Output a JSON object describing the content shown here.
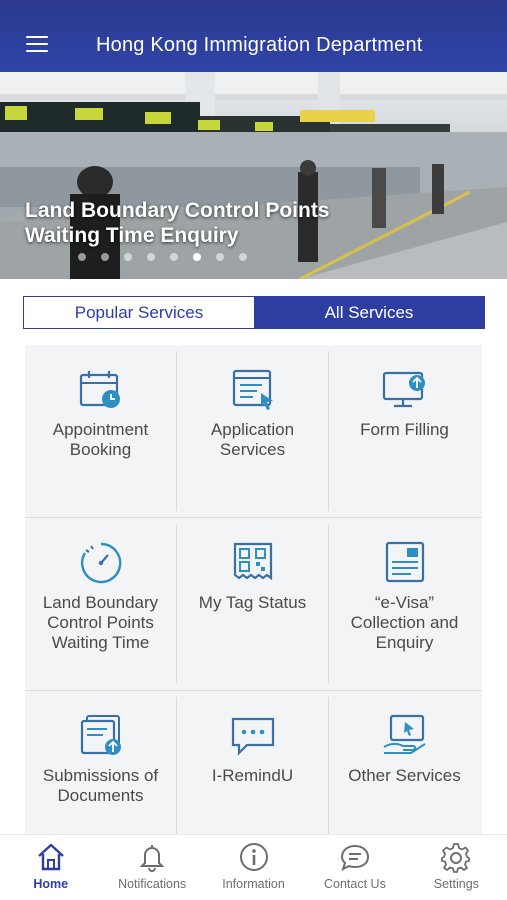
{
  "header": {
    "title": "Hong Kong Immigration Department",
    "menu_icon": "hamburger-icon"
  },
  "banner": {
    "caption_line1": "Land Boundary Control Points",
    "caption_line2": "Waiting Time Enquiry",
    "slide_count": 8,
    "active_slide": 6
  },
  "tabs": {
    "popular": "Popular Services",
    "all": "All Services",
    "selected": "All Services"
  },
  "services": [
    {
      "icon": "calendar-clock-icon",
      "line1": "Appointment",
      "line2": "Booking",
      "line3": ""
    },
    {
      "icon": "browser-cursor-icon",
      "line1": "Application",
      "line2": "Services",
      "line3": ""
    },
    {
      "icon": "monitor-upload-icon",
      "line1": "Form Filling",
      "line2": "",
      "line3": ""
    },
    {
      "icon": "stopwatch-icon",
      "line1": "Land Boundary",
      "line2": "Control Points",
      "line3": "Waiting Time"
    },
    {
      "icon": "qr-tag-icon",
      "line1": "My Tag Status",
      "line2": "",
      "line3": ""
    },
    {
      "icon": "evisa-document-icon",
      "line1": "“e-Visa”",
      "line2": "Collection and",
      "line3": "Enquiry"
    },
    {
      "icon": "documents-upload-icon",
      "line1": "Submissions of",
      "line2": "Documents",
      "line3": ""
    },
    {
      "icon": "chat-bubble-icon",
      "line1": "I-RemindU",
      "line2": "",
      "line3": ""
    },
    {
      "icon": "hand-screen-icon",
      "line1": "Other Services",
      "line2": "",
      "line3": ""
    }
  ],
  "bottom_nav": [
    {
      "icon": "home-icon",
      "label": "Home"
    },
    {
      "icon": "bell-icon",
      "label": "Notifications"
    },
    {
      "icon": "info-icon",
      "label": "Information"
    },
    {
      "icon": "chat-icon",
      "label": "Contact Us"
    },
    {
      "icon": "gear-icon",
      "label": "Settings"
    }
  ],
  "colors": {
    "brand": "#2d3ea0",
    "icon_accent": "#2f8fc2",
    "grid_bg": "#f3f4f6"
  }
}
